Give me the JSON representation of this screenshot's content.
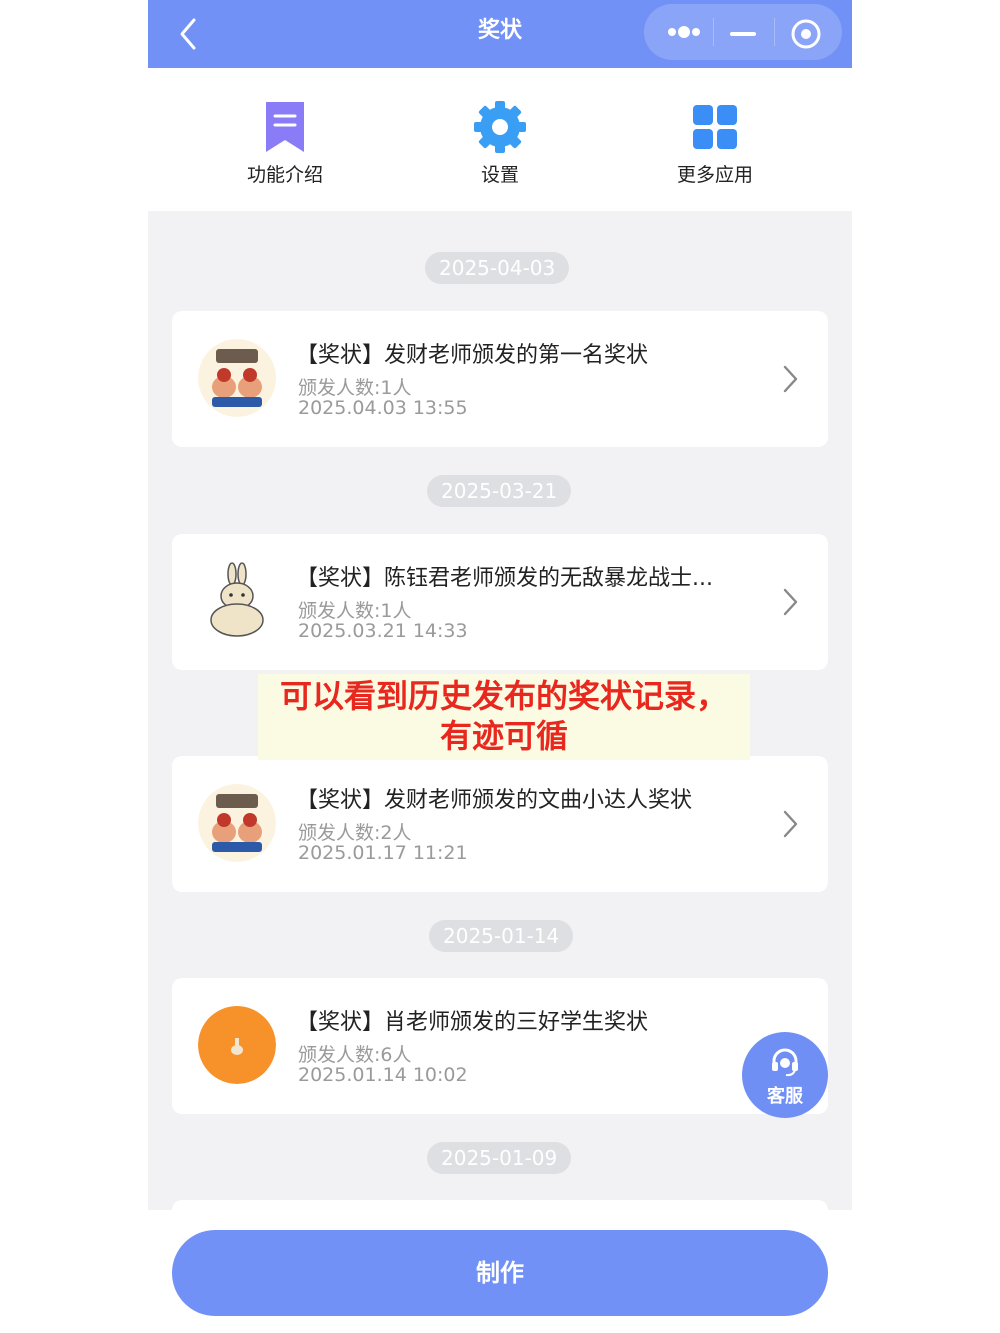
{
  "header": {
    "title": "奖状",
    "back_icon": "chevron-left-icon",
    "capsule": [
      "more-dots-icon",
      "minimize-icon",
      "close-target-icon"
    ]
  },
  "quick_menu": [
    {
      "label": "功能介绍",
      "icon": "bookmark-doc-icon",
      "color": "#8a7cf6"
    },
    {
      "label": "设置",
      "icon": "gear-icon",
      "color": "#3b9ef5"
    },
    {
      "label": "更多应用",
      "icon": "grid-apps-icon",
      "color": "#3b8ef5"
    }
  ],
  "records": [
    {
      "date": "2025-04-03",
      "title": "【奖状】发财老师颁发的第一名奖状",
      "count": "颁发人数:1人",
      "time": "2025.04.03 13:55",
      "avatar": "lucky-cartoon-avatar"
    },
    {
      "date": "2025-03-21",
      "title": "【奖状】陈钰君老师颁发的无敌暴龙战士...",
      "count": "颁发人数:1人",
      "time": "2025.03.21 14:33",
      "avatar": "rabbit-sketch-avatar"
    },
    {
      "date": "",
      "title": "【奖状】发财老师颁发的文曲小达人奖状",
      "count": "颁发人数:2人",
      "time": "2025.01.17 11:21",
      "avatar": "lucky-cartoon-avatar"
    },
    {
      "date": "2025-01-14",
      "title": "【奖状】肖老师颁发的三好学生奖状",
      "count": "颁发人数:6人",
      "time": "2025.01.14 10:02",
      "avatar": "orange-circle-avatar"
    }
  ],
  "next_date": "2025-01-09",
  "overlay_note": {
    "line1": "可以看到历史发布的奖状记录，",
    "line2": "有迹可循"
  },
  "service_button": {
    "label": "客服",
    "icon": "headset-icon"
  },
  "make_button": {
    "label": "制作"
  },
  "colors": {
    "primary": "#7191f6",
    "background": "#f2f2f4",
    "note_text": "#e8281e"
  }
}
